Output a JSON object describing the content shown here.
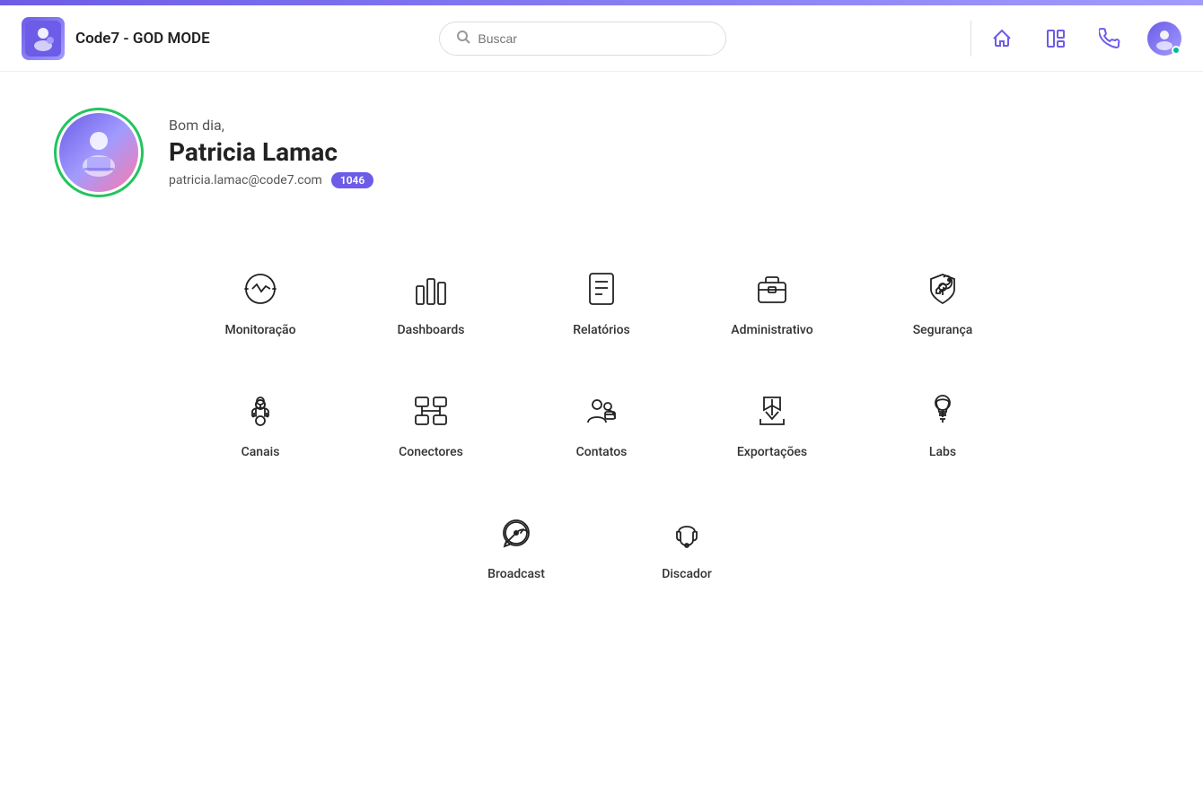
{
  "header": {
    "app_title": "Code7 - GOD MODE",
    "search_placeholder": "Buscar",
    "icons": {
      "home": "⌂",
      "dashboard": "▦",
      "phone": "☎"
    }
  },
  "greeting": {
    "morning_text": "Bom dia,",
    "user_name": "Patricia Lamac",
    "user_email": "patricia.lamac@code7.com",
    "user_badge": "1046"
  },
  "menu_row1": [
    {
      "id": "monitoracao",
      "label": "Monitoração"
    },
    {
      "id": "dashboards",
      "label": "Dashboards"
    },
    {
      "id": "relatorios",
      "label": "Relatórios"
    },
    {
      "id": "administrativo",
      "label": "Administrativo"
    },
    {
      "id": "seguranca",
      "label": "Segurança"
    }
  ],
  "menu_row2": [
    {
      "id": "canais",
      "label": "Canais"
    },
    {
      "id": "conectores",
      "label": "Conectores"
    },
    {
      "id": "contatos",
      "label": "Contatos"
    },
    {
      "id": "exportacoes",
      "label": "Exportações"
    },
    {
      "id": "labs",
      "label": "Labs"
    }
  ],
  "menu_row3": [
    {
      "id": "broadcast",
      "label": "Broadcast"
    },
    {
      "id": "discador",
      "label": "Discador"
    }
  ]
}
